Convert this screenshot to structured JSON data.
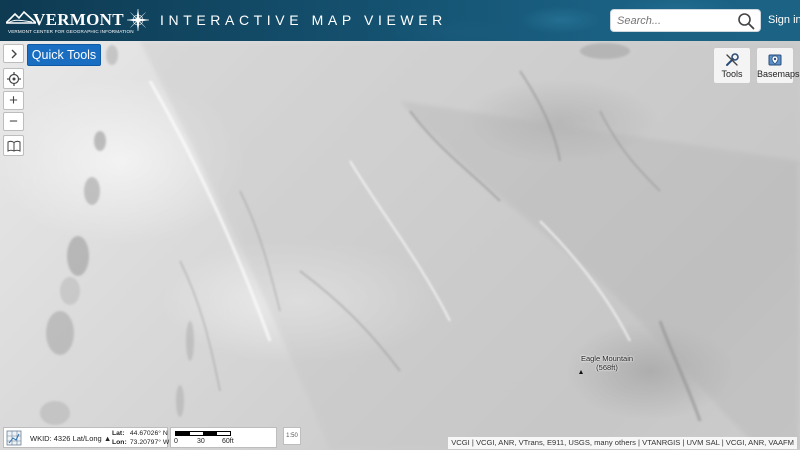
{
  "header": {
    "logo_word": "VERMONT",
    "logo_sub": "VERMONT CENTER FOR GEOGRAPHIC INFORMATION",
    "app_title": "INTERACTIVE MAP VIEWER",
    "search_placeholder": "Search...",
    "signin_label": "Sign in",
    "colors": {
      "bar": "#14506e",
      "text": "#ffffff"
    }
  },
  "sidebar": {
    "expand_icon": "chevron-right-icon",
    "locate_icon": "locate-icon",
    "zoom_in_label": "+",
    "zoom_out_label": "−",
    "bookmark_icon": "book-icon"
  },
  "quick_tools": {
    "label": "Quick Tools",
    "color": "#1a6ec1"
  },
  "top_right": {
    "tools_label": "Tools",
    "basemaps_label": "Basemaps"
  },
  "map": {
    "peak_name": "Eagle Mountain",
    "peak_elevation": "(568ft)"
  },
  "status": {
    "wkid": "WKID: 4326 Lat/Long",
    "lat_label": "Lat:",
    "lat_value": "44.67026° N",
    "lon_label": "Lon:",
    "lon_value": "73.20797° W",
    "scale_labels": [
      "0",
      "30",
      "60ft"
    ],
    "overview_label": "1:50"
  },
  "attribution": "VCGI | VCGI, ANR, VTrans, E911, USGS, many others | VTANRGIS | UVM SAL | VCGI, ANR, VAAFM"
}
